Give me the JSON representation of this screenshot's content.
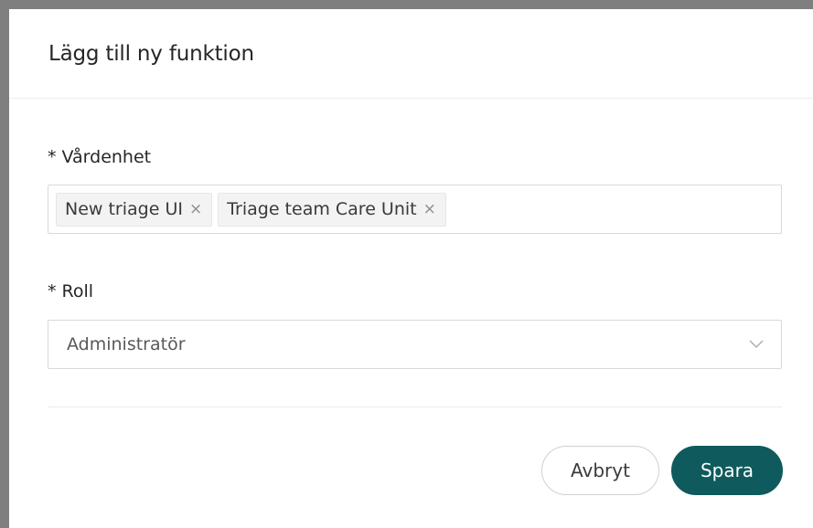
{
  "modal": {
    "title": "Lägg till ny funktion"
  },
  "unit_field": {
    "required_mark": "*",
    "label": "Vårdenhet",
    "tags": [
      {
        "label": "New triage UI",
        "close": "×"
      },
      {
        "label": "Triage team Care Unit",
        "close": "×"
      }
    ]
  },
  "role_field": {
    "required_mark": "*",
    "label": "Roll",
    "value": "Administratör",
    "icon": "chevron-down-icon"
  },
  "footer": {
    "cancel_label": "Avbryt",
    "save_label": "Spara"
  },
  "colors": {
    "primary": "#0f5a5c",
    "backdrop": "#7f7f7f"
  }
}
